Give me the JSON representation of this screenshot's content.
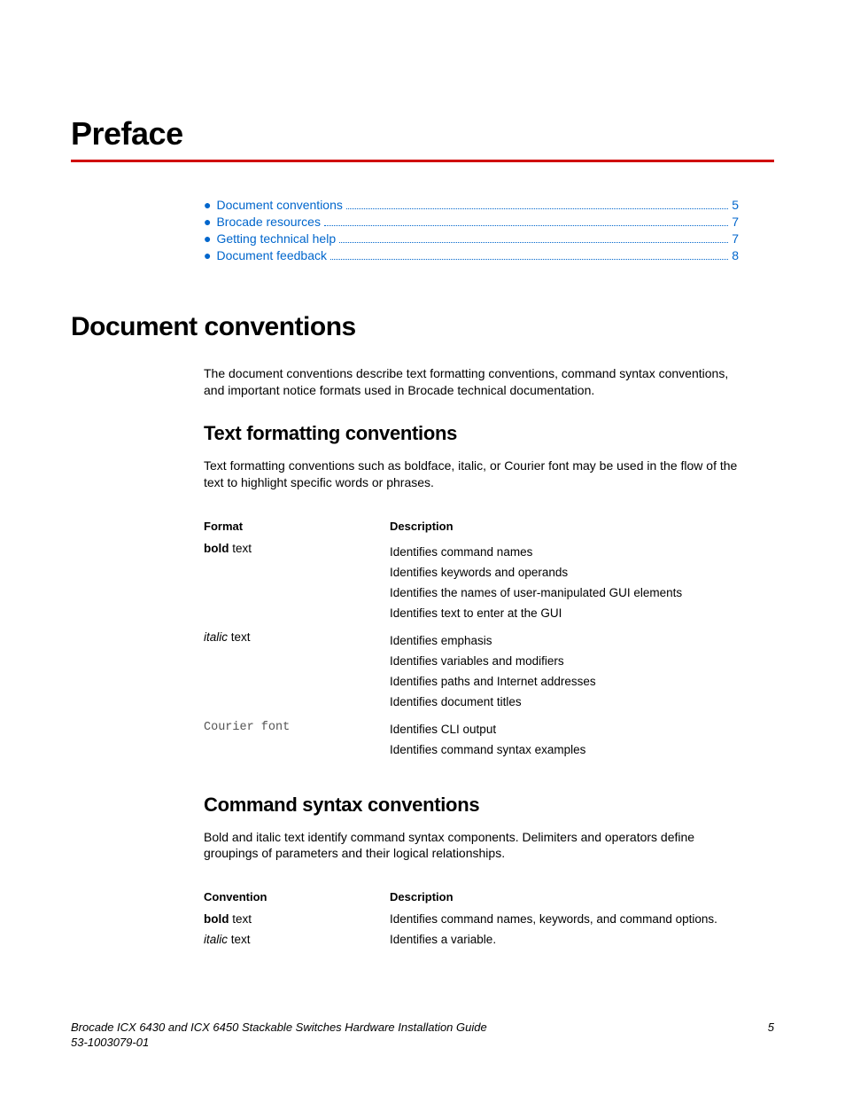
{
  "chapter_title": "Preface",
  "toc": [
    {
      "label": "Document conventions",
      "page": "5"
    },
    {
      "label": "Brocade resources",
      "page": "7"
    },
    {
      "label": "Getting technical help",
      "page": "7"
    },
    {
      "label": "Document feedback",
      "page": "8"
    }
  ],
  "section1": {
    "title": "Document conventions",
    "intro": "The document conventions describe text formatting conventions, command syntax conventions, and important notice formats used in Brocade technical documentation."
  },
  "textfmt": {
    "title": "Text formatting conventions",
    "intro": "Text formatting conventions such as boldface, italic, or Courier font may be used in the flow of the text to highlight specific words or phrases.",
    "col1": "Format",
    "col2": "Description",
    "rows": [
      {
        "fmt_bold": "bold",
        "fmt_rest": " text",
        "desc": [
          "Identifies command names",
          "Identifies keywords and operands",
          "Identifies the names of user-manipulated GUI elements",
          "Identifies text to enter at the GUI"
        ]
      },
      {
        "fmt_italic": "italic",
        "fmt_rest": " text",
        "desc": [
          "Identifies emphasis",
          "Identifies variables and modifiers",
          "Identifies paths and Internet addresses",
          "Identifies document titles"
        ]
      },
      {
        "fmt_courier": "Courier font",
        "desc": [
          "Identifies CLI output",
          "Identifies command syntax examples"
        ]
      }
    ]
  },
  "cmdsyn": {
    "title": "Command syntax conventions",
    "intro": "Bold and italic text identify command syntax components. Delimiters and operators define groupings of parameters and their logical relationships.",
    "col1": "Convention",
    "col2": "Description",
    "rows": [
      {
        "fmt_bold": "bold",
        "fmt_rest": " text",
        "desc": "Identifies command names, keywords, and command options."
      },
      {
        "fmt_italic": "italic",
        "fmt_rest": " text",
        "desc": "Identifies a variable."
      }
    ]
  },
  "footer": {
    "title": "Brocade ICX 6430 and ICX 6450 Stackable Switches Hardware Installation Guide",
    "docnum": "53-1003079-01",
    "page": "5"
  }
}
